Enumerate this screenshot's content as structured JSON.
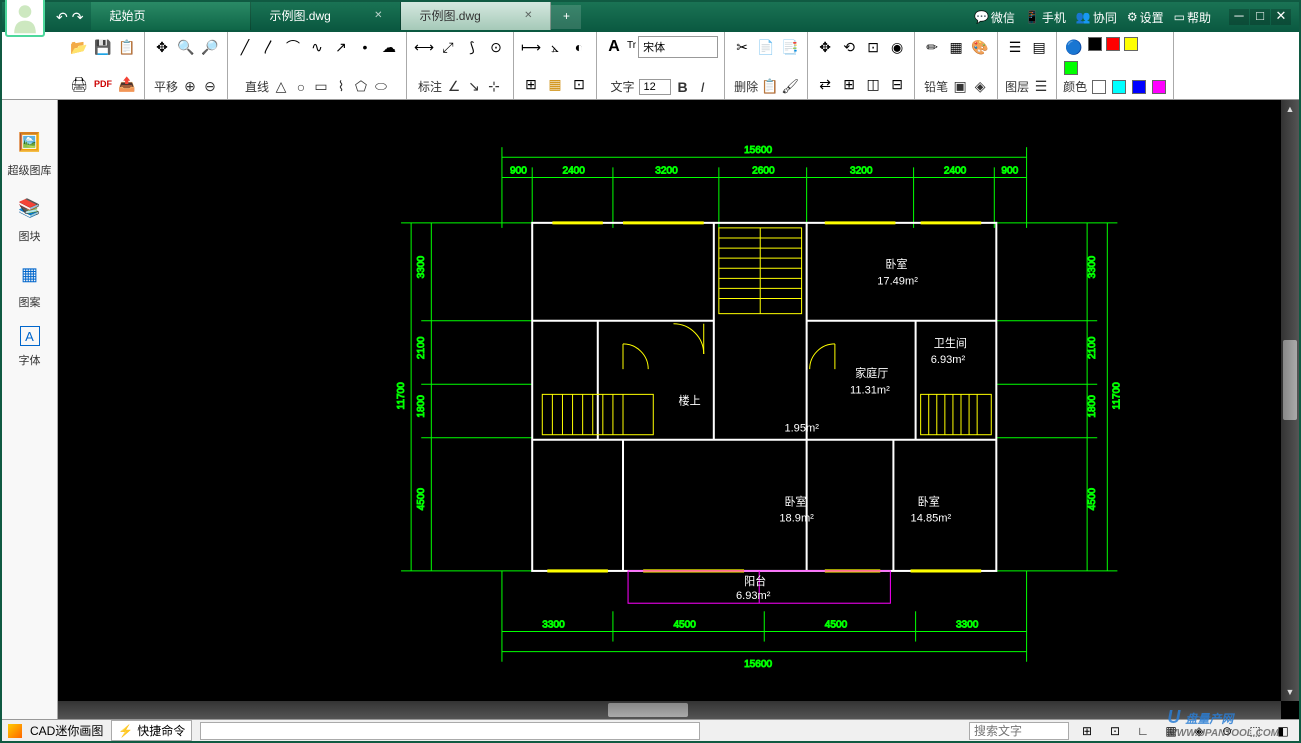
{
  "titlebar": {
    "tabs": [
      {
        "label": "起始页",
        "type": "start"
      },
      {
        "label": "示例图.dwg",
        "type": "file"
      },
      {
        "label": "示例图.dwg",
        "type": "active"
      }
    ],
    "links": {
      "wechat": "微信",
      "mobile": "手机",
      "collab": "协同",
      "settings": "设置",
      "help": "帮助"
    }
  },
  "ribbon": {
    "pan": "平移",
    "line": "直线",
    "annotate": "标注",
    "text": "文字",
    "delete": "删除",
    "pencil": "铅笔",
    "layer": "图层",
    "color": "颜色",
    "font_name": "宋体",
    "font_size": "12",
    "font_prefix": "Tr"
  },
  "sidebar": {
    "items": [
      {
        "icon": "🖼️",
        "label": "超级图库"
      },
      {
        "icon": "📚",
        "label": "图块"
      },
      {
        "icon": "▦",
        "label": "图案"
      },
      {
        "icon": "A",
        "label": "字体"
      }
    ]
  },
  "drawing": {
    "dims_top": {
      "total": "15600",
      "segs": [
        "900",
        "2400",
        "3200",
        "2600",
        "3200",
        "2400",
        "900"
      ]
    },
    "dims_bottom": {
      "total": "15600",
      "segs": [
        "3300",
        "4500",
        "4500",
        "3300"
      ]
    },
    "dims_left": {
      "total": "11700",
      "segs": [
        "3300",
        "2100",
        "1800",
        "4500"
      ]
    },
    "dims_right": {
      "total": "11700",
      "segs": [
        "3300",
        "2100",
        "1800",
        "4500"
      ]
    },
    "rooms": {
      "bedroom1": {
        "name": "卧室",
        "area": "17.49m²"
      },
      "bedroom2": {
        "name": "卧室",
        "area": "18.9m²"
      },
      "bedroom3": {
        "name": "卧室",
        "area": "14.85m²"
      },
      "living": {
        "name": "家庭厅",
        "area": "11.31m²"
      },
      "bath": {
        "name": "卫生间",
        "area": "6.93m²"
      },
      "hall": {
        "name": "",
        "area": "1.95m²"
      },
      "balcony": {
        "name": "阳台",
        "area": "6.93m²"
      },
      "up": "楼上"
    }
  },
  "statusbar": {
    "app": "CAD迷你画图",
    "quick": "快捷命令",
    "search_ph": "搜索文字"
  },
  "watermark": {
    "main": "盘量产网",
    "sub": "WWW.UPANTOOL.COM"
  },
  "colors": {
    "swatches": [
      "#000",
      "#f00",
      "#ff0",
      "#0f0",
      "#0ff",
      "#00f",
      "#f0f",
      "#fff",
      "#800",
      "#880",
      "#080",
      "#088"
    ]
  }
}
